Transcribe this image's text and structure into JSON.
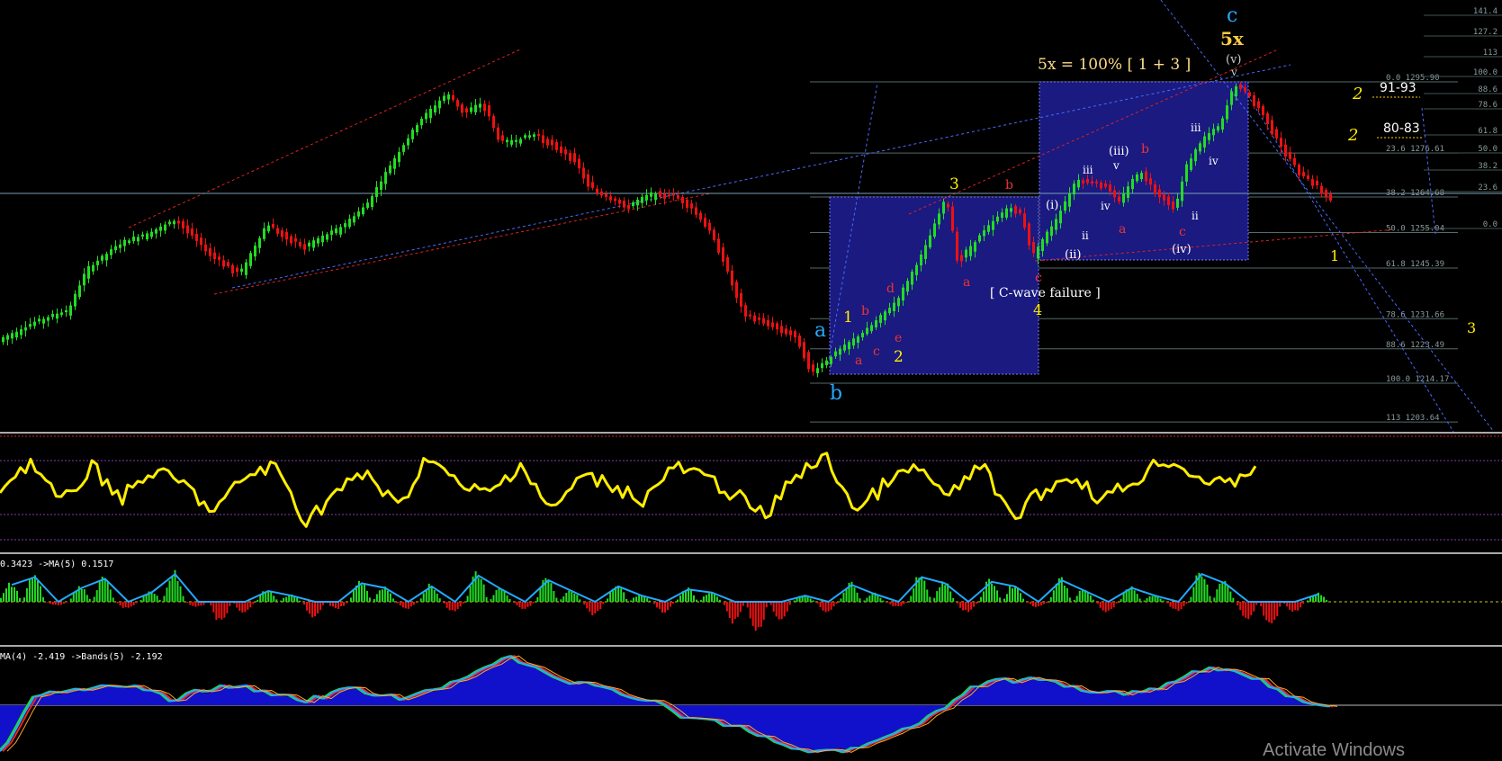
{
  "chart_data": [
    {
      "type": "candlestick",
      "title": "",
      "price_scale": [
        "141.4",
        "127.2",
        "113",
        "100.0",
        "88.6",
        "78.6",
        "61.8",
        "50.0",
        "38.2",
        "23.6",
        "0.0"
      ],
      "fib_levels": [
        {
          "label": "0.0 1295.90",
          "price": 1295.9
        },
        {
          "label": "23.6 1276.61",
          "price": 1276.61
        },
        {
          "label": "38.2 1264.68",
          "price": 1264.68
        },
        {
          "label": "50.0 1255.04",
          "price": 1255.04
        },
        {
          "label": "61.8 1245.39",
          "price": 1245.39
        },
        {
          "label": "78.6 1231.66",
          "price": 1231.66
        },
        {
          "label": "88.6 1223.49",
          "price": 1223.49
        },
        {
          "label": "100.0 1214.17",
          "price": 1214.17
        },
        {
          "label": "113 1203.64",
          "price": 1203.64
        }
      ],
      "wave_labels": {
        "c_top": "c",
        "fivex": "5x",
        "v_paren": "(v)",
        "v": "v",
        "a_left": "a",
        "b_left": "b",
        "w1": "1",
        "w2": "2",
        "w3": "3",
        "w4": "4",
        "sub_a": "a",
        "sub_b": "b",
        "sub_c": "c",
        "sub_d": "d",
        "sub_e": "e",
        "i_paren": "(i)",
        "ii_paren": "(ii)",
        "iii_paren": "(iii)",
        "iv_paren": "(iv)",
        "iii": "iii",
        "iv": "iv",
        "ii": "ii",
        "r2_9193": "2",
        "r2_8083": "2",
        "target1": "1",
        "target3": "3"
      },
      "annotations": {
        "formula": "5x = 100% [ 1 + 3 ]",
        "cwave": "[ C-wave failure ]",
        "zone_91_93": "91-93",
        "zone_80_83": "80-83"
      }
    },
    {
      "type": "line",
      "title": "",
      "series": [
        {
          "values": [
            0.52,
            0.78,
            0.35,
            0.72,
            0.42,
            0.68,
            0.55,
            0.27,
            0.63,
            0.73,
            0.18,
            0.48,
            0.66,
            0.31,
            0.85,
            0.52,
            0.46,
            0.76,
            0.28,
            0.63,
            0.55,
            0.39,
            0.72,
            0.62,
            0.45,
            0.22,
            0.66,
            0.8,
            0.28,
            0.58,
            0.71,
            0.4,
            0.77,
            0.21,
            0.47,
            0.64,
            0.4,
            0.57,
            0.81,
            0.65,
            0.52,
            0.73
          ]
        }
      ]
    },
    {
      "type": "bar",
      "title": "",
      "header": "0.3423 ->MA(5) 0.1517",
      "values": [
        0.55,
        0.8,
        -0.1,
        0.45,
        0.75,
        -0.2,
        0.3,
        0.9,
        -0.15,
        -0.6,
        -0.3,
        0.35,
        0.2,
        -0.5,
        -0.2,
        0.6,
        0.45,
        -0.2,
        0.5,
        -0.3,
        0.85,
        0.4,
        -0.2,
        0.7,
        0.35,
        -0.4,
        0.5,
        0.2,
        -0.3,
        0.4,
        0.3,
        -0.6,
        -0.9,
        -0.5,
        0.2,
        -0.3,
        0.55,
        0.25,
        -0.15,
        0.8,
        0.6,
        -0.3,
        0.65,
        0.5,
        -0.15,
        0.7,
        0.35,
        -0.3,
        0.45,
        0.2,
        -0.25,
        0.9,
        0.6,
        -0.5,
        -0.7,
        -0.3,
        0.25
      ]
    },
    {
      "type": "area",
      "title": "",
      "header": "MA(4) -2.419 ->Bands(5) -2.192",
      "values": [
        -0.9,
        0.2,
        0.25,
        0.35,
        0.3,
        0.15,
        0.25,
        0.4,
        0.2,
        0.1,
        0.3,
        0.2,
        0.15,
        0.3,
        0.7,
        0.85,
        0.6,
        0.4,
        0.3,
        0.1,
        -0.2,
        -0.3,
        -0.5,
        -0.7,
        -0.9,
        -0.8,
        -0.6,
        -0.3,
        0.1,
        0.45,
        0.5,
        0.4,
        0.3,
        0.2,
        0.35,
        0.6,
        0.7,
        0.45,
        0.1,
        0.0
      ]
    }
  ],
  "watermark": "Activate Windows",
  "colors": {
    "up": "#22dd22",
    "down": "#ee1111",
    "yellow": "#ffee00",
    "box": "#1a1a80",
    "cyan": "#22aaff",
    "cyanline": "#22c8ff",
    "fibline": "#556a6a"
  }
}
